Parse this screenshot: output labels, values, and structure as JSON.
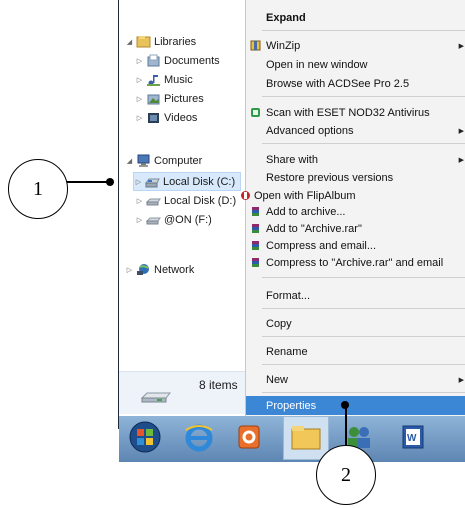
{
  "nav": {
    "items": [
      {
        "label": "Libraries",
        "icon": "libraries-icon"
      },
      {
        "label": "Documents",
        "icon": "documents-icon"
      },
      {
        "label": "Music",
        "icon": "music-icon"
      },
      {
        "label": "Pictures",
        "icon": "pictures-icon"
      },
      {
        "label": "Videos",
        "icon": "videos-icon"
      },
      {
        "label": "Computer",
        "icon": "computer-icon"
      },
      {
        "label": "Local Disk (C:)",
        "icon": "drive-icon"
      },
      {
        "label": "Local Disk (D:)",
        "icon": "drive-icon"
      },
      {
        "label": "@ON (F:)",
        "icon": "drive-icon"
      },
      {
        "label": "Network",
        "icon": "network-icon"
      }
    ],
    "status": "8 items"
  },
  "menu": {
    "items": [
      {
        "label": "Expand",
        "bold": true
      },
      {
        "label": "WinZip",
        "icon": "winzip-icon",
        "submenu": true
      },
      {
        "label": "Open in new window"
      },
      {
        "label": "Browse with ACDSee Pro 2.5"
      },
      {
        "label": "Scan with ESET NOD32 Antivirus",
        "icon": "eset-icon"
      },
      {
        "label": "Advanced options",
        "submenu": true
      },
      {
        "label": "Share with",
        "submenu": true
      },
      {
        "label": "Restore previous versions"
      },
      {
        "label": "Open with FlipAlbum",
        "icon": "flipalbum-icon"
      },
      {
        "label": "Add to archive...",
        "icon": "winrar-icon"
      },
      {
        "label": "Add to \"Archive.rar\"",
        "icon": "winrar-icon"
      },
      {
        "label": "Compress and email...",
        "icon": "winrar-icon"
      },
      {
        "label": "Compress to \"Archive.rar\" and email",
        "icon": "winrar-icon"
      },
      {
        "label": "Format..."
      },
      {
        "label": "Copy"
      },
      {
        "label": "Rename"
      },
      {
        "label": "New",
        "submenu": true
      },
      {
        "label": "Properties",
        "highlighted": true
      }
    ]
  },
  "taskbar": {
    "items": [
      "start-orb-icon",
      "internet-explorer-icon",
      "outlook-icon",
      "file-explorer-icon",
      "people-icon",
      "word-icon"
    ]
  },
  "callouts": {
    "one": "1",
    "two": "2"
  },
  "colors": {
    "menu_highlight": "#3c86d6",
    "selection": "#d7e9fb",
    "taskbar": "#6f97c2"
  }
}
